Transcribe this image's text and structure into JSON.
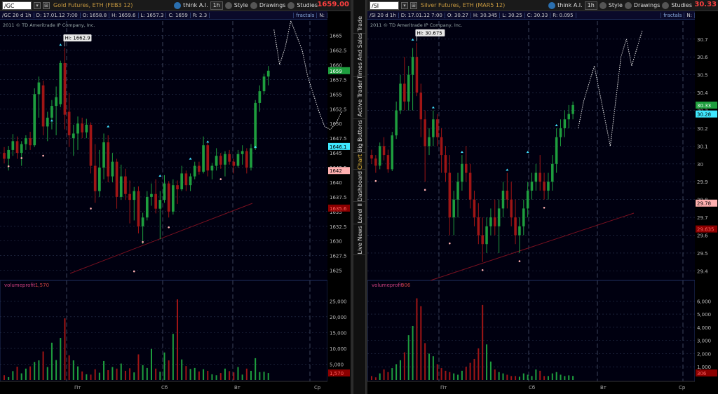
{
  "left": {
    "symbol": "/GC",
    "title": "Gold Futures, ETH (FEB3 12)",
    "ai": "think A.I.",
    "timeframe": "1h",
    "style": "Style",
    "drawings": "Drawings",
    "studies": "Studies",
    "last_price": "1659.00",
    "info": {
      "agg": "/GC 20 d 1h",
      "date": "D: 17.01.12 7:00",
      "open": "O: 1658.8",
      "high": "H: 1659.6",
      "low": "L: 1657.3",
      "close": "C: 1659",
      "range": "R: 2.3",
      "fractals": "fractals",
      "n": "N:"
    },
    "copyright": "2011 © TD Ameritrade IP Company, Inc.",
    "hi_label": "Hi: 1662.9",
    "y_ticks": [
      "1665",
      "1662.5",
      "1660",
      "1657.5",
      "1655",
      "1652.5",
      "1650",
      "1647.5",
      "1645",
      "1642.5",
      "1640",
      "1637.5",
      "1635",
      "1632.5",
      "1630",
      "1627.5",
      "1625"
    ],
    "y_min": 1624,
    "y_max": 1666.5,
    "tags": [
      {
        "text": "1659",
        "value": 1659,
        "bg": "#1e9e3e",
        "fg": "#fff"
      },
      {
        "text": "1646.1",
        "value": 1646.1,
        "bg": "#40e8ff",
        "fg": "#000"
      },
      {
        "text": "1642",
        "value": 1642,
        "bg": "#ffb0b0",
        "fg": "#000"
      },
      {
        "text": "1635.6",
        "value": 1635.6,
        "bg": "#8b0000",
        "fg": "#ff6060"
      }
    ],
    "vol_label": "volumeprofit",
    "vol_val": "1,570",
    "vol_ticks": [
      "25,000",
      "20,000",
      "15,000",
      "10,000",
      "5,000"
    ],
    "vol_max": 27500,
    "vol_tag": "1,570",
    "x_labels": [
      "Пт",
      "Сб",
      "Вт",
      "Ср"
    ],
    "candles": [
      [
        1645,
        1646,
        1643.2,
        1644
      ],
      [
        1644,
        1646.2,
        1642,
        1645.5
      ],
      [
        1645.5,
        1648.2,
        1644.5,
        1647
      ],
      [
        1647,
        1647.8,
        1644,
        1645
      ],
      [
        1645,
        1647,
        1642.8,
        1646.5
      ],
      [
        1646.5,
        1648,
        1645.5,
        1647.5
      ],
      [
        1647.5,
        1648.6,
        1645.5,
        1646.3
      ],
      [
        1646.3,
        1656,
        1646,
        1655
      ],
      [
        1655,
        1658,
        1651,
        1657
      ],
      [
        1656.5,
        1657.3,
        1648,
        1649.5
      ],
      [
        1649.5,
        1652,
        1647,
        1651
      ],
      [
        1651,
        1654,
        1649,
        1653
      ],
      [
        1653,
        1656.3,
        1648,
        1654.5
      ],
      [
        1653.3,
        1660.7,
        1652.8,
        1660.3
      ],
      [
        1660.3,
        1662.9,
        1649,
        1651.5
      ],
      [
        1652,
        1655.2,
        1646,
        1648
      ],
      [
        1647.5,
        1649.8,
        1644.5,
        1648.3
      ],
      [
        1648.3,
        1651.2,
        1645.5,
        1650
      ],
      [
        1650,
        1651,
        1647.5,
        1648.5
      ],
      [
        1648.5,
        1650.8,
        1647.5,
        1649.8
      ],
      [
        1649.8,
        1650.2,
        1641.5,
        1642.8
      ],
      [
        1642.8,
        1646.5,
        1636.5,
        1638.5
      ],
      [
        1638.5,
        1645.5,
        1637.5,
        1642.5
      ],
      [
        1642.5,
        1648.3,
        1640.5,
        1646.8
      ],
      [
        1646.8,
        1648,
        1640,
        1641
      ],
      [
        1641,
        1645,
        1640,
        1643.5
      ],
      [
        1643.5,
        1644,
        1635.5,
        1637.5
      ],
      [
        1637.5,
        1643,
        1637,
        1641
      ],
      [
        1641,
        1642.3,
        1637,
        1638
      ],
      [
        1638,
        1640.3,
        1633,
        1637
      ],
      [
        1637,
        1639.2,
        1633.5,
        1638.5
      ],
      [
        1638.5,
        1639.3,
        1631.3,
        1632.5
      ],
      [
        1632.5,
        1634.8,
        1629.5,
        1634
      ],
      [
        1634,
        1638.5,
        1633.5,
        1637.5
      ],
      [
        1637.5,
        1639.8,
        1636,
        1638
      ],
      [
        1638,
        1640.5,
        1634.7,
        1635.5
      ],
      [
        1635.5,
        1638.5,
        1630.3,
        1637
      ],
      [
        1637,
        1641.2,
        1636.5,
        1639.8
      ],
      [
        1639.8,
        1640.2,
        1634,
        1635
      ],
      [
        1635,
        1640.5,
        1634.5,
        1639.5
      ],
      [
        1639.5,
        1640.3,
        1636.3,
        1638.8
      ],
      [
        1638.8,
        1642.8,
        1638.5,
        1641.5
      ],
      [
        1641.5,
        1642,
        1638.5,
        1639.5
      ],
      [
        1639.5,
        1641.5,
        1638.5,
        1641
      ],
      [
        1641,
        1643.5,
        1640.5,
        1642.8
      ],
      [
        1642.8,
        1643.5,
        1641.3,
        1641.8
      ],
      [
        1641.8,
        1647.8,
        1641.5,
        1646.3
      ],
      [
        1646.3,
        1646.8,
        1641,
        1642
      ],
      [
        1642,
        1643.3,
        1640.5,
        1642.8
      ],
      [
        1642.8,
        1645.8,
        1642,
        1644.5
      ],
      [
        1644.5,
        1645,
        1642.3,
        1643
      ],
      [
        1643,
        1645.3,
        1641,
        1644.8
      ],
      [
        1644.8,
        1645.5,
        1643,
        1643.5
      ],
      [
        1643.5,
        1644,
        1641.5,
        1642.8
      ],
      [
        1642.8,
        1645.5,
        1642.5,
        1644.8
      ],
      [
        1644.8,
        1646.3,
        1643,
        1645.3
      ],
      [
        1645.3,
        1645.8,
        1641.5,
        1642.5
      ],
      [
        1642.5,
        1646.5,
        1642,
        1645.8
      ],
      [
        1645.8,
        1654,
        1645.5,
        1653.5
      ],
      [
        1653.5,
        1656.5,
        1652,
        1655.5
      ],
      [
        1655.5,
        1658.5,
        1655,
        1658
      ],
      [
        1658,
        1659.8,
        1656.5,
        1659
      ]
    ],
    "volumes": [
      1500,
      900,
      2800,
      4200,
      2100,
      3600,
      4300,
      5700,
      6200,
      9000,
      4100,
      11800,
      6300,
      13300,
      19500,
      7800,
      6200,
      4300,
      2700,
      1800,
      1700,
      3400,
      2300,
      6000,
      3100,
      4100,
      3600,
      5200,
      2900,
      3700,
      2400,
      8100,
      4700,
      3800,
      9800,
      3600,
      2600,
      8700,
      6200,
      14600,
      25500,
      6500,
      4400,
      3500,
      3800,
      2700,
      3400,
      2900,
      1800,
      1500,
      2200,
      3600,
      2800,
      2400,
      4100,
      1700,
      3600,
      2900,
      6900,
      2500,
      2600,
      2200
    ],
    "up_fractals": [
      {
        "i": 11,
        "v": 1650
      },
      {
        "i": 13,
        "v": 1662.9
      },
      {
        "i": 24,
        "v": 1649
      },
      {
        "i": 36,
        "v": 1640.6
      },
      {
        "i": 43,
        "v": 1643.5
      },
      {
        "i": 47,
        "v": 1646.4
      },
      {
        "i": 58,
        "v": 1645.5
      }
    ],
    "down_fractals": [
      {
        "i": 1,
        "v": 1643.2
      },
      {
        "i": 4,
        "v": 1644.6
      },
      {
        "i": 9,
        "v": 1645
      },
      {
        "i": 20,
        "v": 1636
      },
      {
        "i": 32,
        "v": 1630.3
      },
      {
        "i": 30,
        "v": 1625.3
      },
      {
        "i": 38,
        "v": 1632.8
      },
      {
        "i": 50,
        "v": 1641
      }
    ],
    "projection": [
      [
        1661,
        1666
      ],
      [
        1663,
        1660
      ],
      [
        1665,
        1663
      ],
      [
        1667,
        1667.5
      ],
      [
        1669,
        1665
      ],
      [
        1671,
        1662.5
      ],
      [
        1673,
        1658
      ],
      [
        1675,
        1655
      ],
      [
        1677,
        1652
      ],
      [
        1679,
        1649.5
      ],
      [
        1681,
        1649
      ],
      [
        1683,
        1650
      ],
      [
        1685,
        1652
      ]
    ]
  },
  "right": {
    "symbol": "/SI",
    "title": "Silver Futures, ETH (MAR5 12)",
    "ai": "think A.I.",
    "timeframe": "1h",
    "style": "Style",
    "drawings": "Drawings",
    "studies": "Studies",
    "last_price": "30.33",
    "info": {
      "agg": "/SI 20 d 1h",
      "date": "D: 17.01.12 7:00",
      "open": "O: 30.27",
      "high": "H: 30.345",
      "low": "L: 30.25",
      "close": "C: 30.33",
      "range": "R: 0.095",
      "fractals": "fractals",
      "n": "N:"
    },
    "copyright": "2011 © TD Ameritrade IP Company, Inc.",
    "hi_label": "Hi: 30.675",
    "y_ticks": [
      "30.7",
      "30.6",
      "30.5",
      "30.4",
      "30.3",
      "30.2",
      "30.1",
      "30",
      "29.9",
      "29.8",
      "29.7",
      "29.6",
      "29.5",
      "29.4"
    ],
    "y_min": 29.37,
    "y_max": 30.77,
    "tags": [
      {
        "text": "30.33",
        "value": 30.33,
        "bg": "#1e9e3e",
        "fg": "#fff"
      },
      {
        "text": "30.28",
        "value": 30.28,
        "bg": "#40e8ff",
        "fg": "#000"
      },
      {
        "text": "29.78",
        "value": 29.78,
        "bg": "#ffb0b0",
        "fg": "#000"
      },
      {
        "text": "29.635",
        "value": 29.635,
        "bg": "#8b0000",
        "fg": "#ff6060"
      }
    ],
    "vol_label": "volumeprofit",
    "vol_val": "306",
    "vol_ticks": [
      "6,000",
      "5,000",
      "4,000",
      "3,000",
      "2,000",
      "1,000"
    ],
    "vol_max": 6600,
    "vol_tag": "306",
    "x_labels": [
      "Пт",
      "Сб",
      "Вт",
      "Ср"
    ],
    "candles": [
      [
        30.05,
        30.08,
        30,
        30.03
      ],
      [
        30.03,
        30.05,
        29.95,
        29.99
      ],
      [
        29.99,
        30.12,
        29.97,
        30.1
      ],
      [
        30.1,
        30.15,
        30.02,
        30.05
      ],
      [
        30.05,
        30.08,
        29.95,
        29.97
      ],
      [
        29.97,
        30.18,
        29.96,
        30.16
      ],
      [
        30.16,
        30.35,
        30.14,
        30.3
      ],
      [
        30.3,
        30.5,
        30.28,
        30.45
      ],
      [
        30.45,
        30.6,
        30.3,
        30.35
      ],
      [
        30.35,
        30.55,
        30.3,
        30.5
      ],
      [
        30.5,
        30.65,
        30.3,
        30.6
      ],
      [
        30.6,
        30.68,
        30.38,
        30.4
      ],
      [
        30.4,
        30.45,
        30.15,
        30.25
      ],
      [
        30.25,
        30.3,
        29.9,
        30.1
      ],
      [
        30.1,
        30.2,
        30.05,
        30.15
      ],
      [
        30.15,
        30.3,
        30.1,
        30.25
      ],
      [
        30.25,
        30.28,
        30.1,
        30.15
      ],
      [
        30.15,
        30.2,
        29.95,
        30.05
      ],
      [
        30.05,
        30.1,
        29.9,
        29.95
      ],
      [
        29.95,
        30.05,
        29.6,
        29.7
      ],
      [
        29.7,
        29.85,
        29.6,
        29.8
      ],
      [
        29.8,
        29.95,
        29.7,
        29.9
      ],
      [
        29.9,
        30.05,
        29.85,
        30
      ],
      [
        30,
        30.1,
        29.9,
        29.95
      ],
      [
        29.95,
        30,
        29.75,
        29.8
      ],
      [
        29.8,
        29.85,
        29.65,
        29.7
      ],
      [
        29.7,
        29.78,
        29.55,
        29.6
      ],
      [
        29.6,
        29.7,
        29.45,
        29.55
      ],
      [
        29.55,
        29.7,
        29.5,
        29.65
      ],
      [
        29.65,
        29.75,
        29.6,
        29.7
      ],
      [
        29.7,
        29.8,
        29.6,
        29.65
      ],
      [
        29.65,
        29.8,
        29.5,
        29.75
      ],
      [
        29.75,
        29.9,
        29.7,
        29.85
      ],
      [
        29.85,
        29.95,
        29.75,
        29.8
      ],
      [
        29.8,
        29.9,
        29.65,
        29.7
      ],
      [
        29.7,
        29.8,
        29.55,
        29.6
      ],
      [
        29.6,
        29.7,
        29.5,
        29.65
      ],
      [
        29.65,
        29.8,
        29.6,
        29.75
      ],
      [
        29.75,
        29.9,
        29.7,
        29.85
      ],
      [
        29.85,
        29.95,
        29.8,
        29.9
      ],
      [
        29.9,
        30,
        29.85,
        29.95
      ],
      [
        29.95,
        30.05,
        29.85,
        29.9
      ],
      [
        29.9,
        29.95,
        29.8,
        29.85
      ],
      [
        29.85,
        29.95,
        29.8,
        29.9
      ],
      [
        29.9,
        30.05,
        29.85,
        30
      ],
      [
        30,
        30.2,
        29.95,
        30.15
      ],
      [
        30.15,
        30.25,
        30.1,
        30.2
      ],
      [
        30.2,
        30.3,
        30.15,
        30.25
      ],
      [
        30.25,
        30.33,
        30.2,
        30.28
      ],
      [
        30.28,
        30.35,
        30.25,
        30.33
      ]
    ],
    "volumes": [
      300,
      200,
      500,
      800,
      600,
      900,
      1200,
      1500,
      2100,
      3400,
      4100,
      6200,
      5600,
      2800,
      2000,
      1800,
      1200,
      900,
      700,
      600,
      500,
      400,
      700,
      1000,
      1300,
      1600,
      2400,
      5700,
      2700,
      1400,
      800,
      600,
      500,
      400,
      300,
      300,
      250,
      500,
      400,
      300,
      800,
      700,
      300,
      300,
      500,
      600,
      400,
      300,
      350,
      306
    ],
    "up_fractals": [
      {
        "i": 10,
        "v": 30.68
      },
      {
        "i": 15,
        "v": 30.3
      },
      {
        "i": 22,
        "v": 30.05
      },
      {
        "i": 33,
        "v": 29.95
      },
      {
        "i": 38,
        "v": 30.05
      },
      {
        "i": 45,
        "v": 30.2
      }
    ],
    "down_fractals": [
      {
        "i": 1,
        "v": 29.92
      },
      {
        "i": 13,
        "v": 29.87
      },
      {
        "i": 19,
        "v": 29.57
      },
      {
        "i": 27,
        "v": 29.42
      },
      {
        "i": 36,
        "v": 29.47
      },
      {
        "i": 42,
        "v": 29.77
      }
    ],
    "projection": [
      [
        51,
        30.2
      ],
      [
        53,
        30.35
      ],
      [
        55,
        30.45
      ],
      [
        57,
        30.55
      ],
      [
        59,
        30.4
      ],
      [
        61,
        30.25
      ],
      [
        63,
        30.1
      ],
      [
        65,
        30.35
      ],
      [
        67,
        30.6
      ],
      [
        69,
        30.7
      ],
      [
        71,
        30.55
      ],
      [
        73,
        30.65
      ],
      [
        75,
        30.75
      ]
    ]
  },
  "side_tabs": [
    "Trade",
    "Times And Sales",
    "Active Trader",
    "Big Buttons",
    "Chart",
    "Dashboard",
    "Level II",
    "Live News"
  ],
  "colors": {
    "up": "#1e9e3e",
    "down": "#a01515",
    "grid": "#2a3550",
    "bg": "#000010",
    "fractal_up": "#40e0ff",
    "fractal_down": "#ffb0b0"
  }
}
